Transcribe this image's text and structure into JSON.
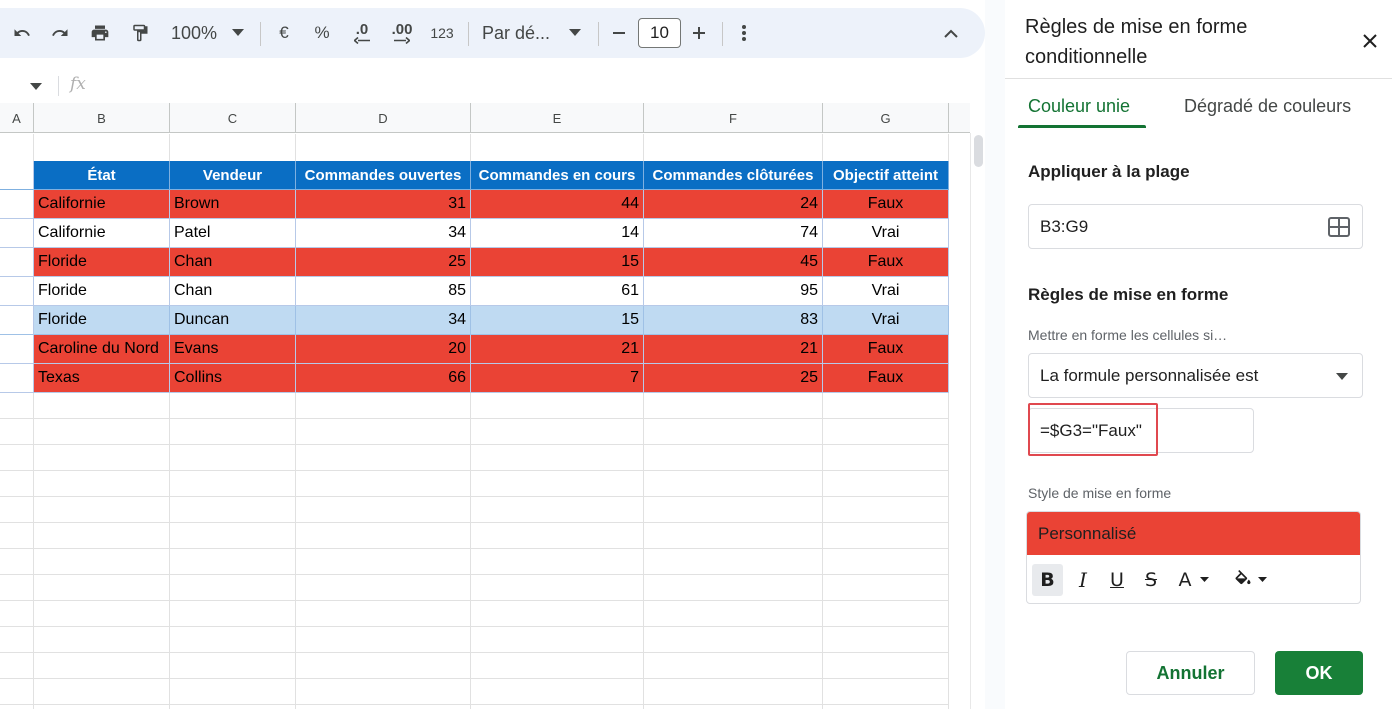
{
  "toolbar": {
    "zoom": "100%",
    "currency_symbol": "€",
    "percent_symbol": "%",
    "decrease_decimals": ".0",
    "increase_decimals": ".00",
    "number_format": "123",
    "font_family": "Par dé...",
    "font_size": "10"
  },
  "formula_bar": {
    "fx": "fx"
  },
  "sheet": {
    "columns": [
      "A",
      "B",
      "C",
      "D",
      "E",
      "F",
      "G"
    ],
    "header": [
      "État",
      "Vendeur",
      "Commandes ouvertes",
      "Commandes en cours",
      "Commandes clôturées",
      "Objectif atteint"
    ],
    "rows": [
      [
        "Californie",
        "Brown",
        "31",
        "44",
        "24",
        "Faux"
      ],
      [
        "Californie",
        "Patel",
        "34",
        "14",
        "74",
        "Vrai"
      ],
      [
        "Floride",
        "Chan",
        "25",
        "15",
        "45",
        "Faux"
      ],
      [
        "Floride",
        "Chan",
        "85",
        "61",
        "95",
        "Vrai"
      ],
      [
        "Floride",
        "Duncan",
        "34",
        "15",
        "83",
        "Vrai"
      ],
      [
        "Caroline du Nord",
        "Evans",
        "20",
        "21",
        "21",
        "Faux"
      ],
      [
        "Texas",
        "Collins",
        "66",
        "7",
        "25",
        "Faux"
      ]
    ],
    "colors": {
      "header": "#0a6ec4",
      "false_row": "#ea4335",
      "selected_row": "#bfdaf2"
    }
  },
  "panel": {
    "title": "Règles de mise en forme conditionnelle",
    "tabs": {
      "solid": "Couleur unie",
      "gradient": "Dégradé de couleurs"
    },
    "apply_label": "Appliquer à la plage",
    "range": "B3:G9",
    "rules_label": "Règles de mise en forme",
    "condition_label": "Mettre en forme les cellules si…",
    "condition": "La formule personnalisée est",
    "formula": "=$G3=\"Faux\"",
    "style_label": "Style de mise en forme",
    "style_preview": "Personnalisé",
    "style_buttons": {
      "bold": "B",
      "italic": "I",
      "underline": "U",
      "strike": "S",
      "text_color": "A"
    },
    "cancel": "Annuler",
    "ok": "OK",
    "accent": "#137333"
  }
}
